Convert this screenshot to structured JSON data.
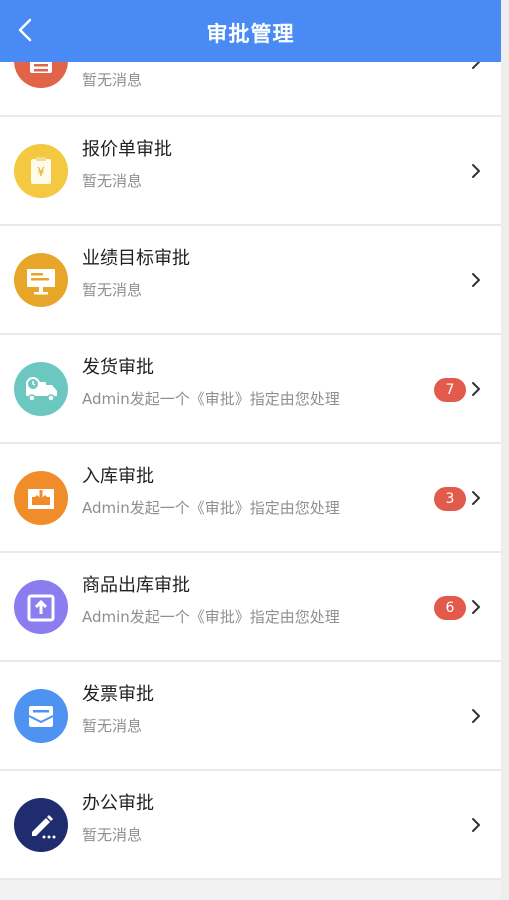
{
  "header": {
    "title": "审批管理"
  },
  "list": {
    "items": [
      {
        "name": "",
        "sub": "暂无消息",
        "badge": "",
        "icon": "document-icon",
        "color": "#e0634a"
      },
      {
        "name": "报价单审批",
        "sub": "暂无消息",
        "badge": "",
        "icon": "quote-icon",
        "color": "#f5c842"
      },
      {
        "name": "业绩目标审批",
        "sub": "暂无消息",
        "badge": "",
        "icon": "presentation-icon",
        "color": "#e8a628"
      },
      {
        "name": "发货审批",
        "sub": "Admin发起一个《审批》指定由您处理",
        "badge": "7",
        "icon": "delivery-truck-icon",
        "color": "#6cc7c0"
      },
      {
        "name": "入库审批",
        "sub": "Admin发起一个《审批》指定由您处理",
        "badge": "3",
        "icon": "inbox-download-icon",
        "color": "#f08c2a"
      },
      {
        "name": "商品出库审批",
        "sub": "Admin发起一个《审批》指定由您处理",
        "badge": "6",
        "icon": "box-upload-icon",
        "color": "#8b7cf0"
      },
      {
        "name": "发票审批",
        "sub": "暂无消息",
        "badge": "",
        "icon": "invoice-mail-icon",
        "color": "#4f93f2"
      },
      {
        "name": "办公审批",
        "sub": "暂无消息",
        "badge": "",
        "icon": "edit-pen-icon",
        "color": "#1f2c6e"
      }
    ]
  }
}
